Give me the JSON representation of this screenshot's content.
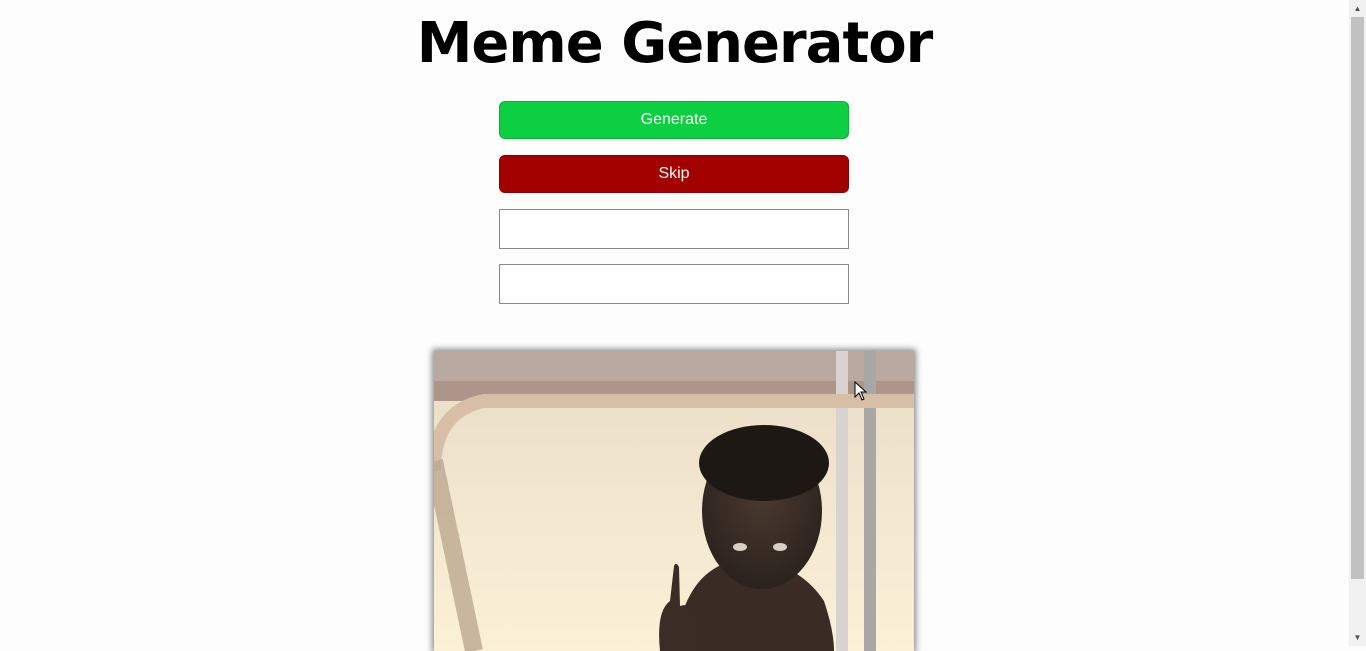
{
  "page": {
    "title": "Meme Generator"
  },
  "controls": {
    "generate_label": "Generate",
    "skip_label": "Skip",
    "top_text": {
      "value": "",
      "placeholder": ""
    },
    "bottom_text": {
      "value": "",
      "placeholder": ""
    }
  },
  "meme": {
    "image_icon": "meme-photo",
    "image_text": ""
  },
  "colors": {
    "generate": "#0ccf42",
    "skip": "#a30000"
  },
  "icons": {
    "scroll_up": "▲",
    "scroll_down": "▼"
  }
}
